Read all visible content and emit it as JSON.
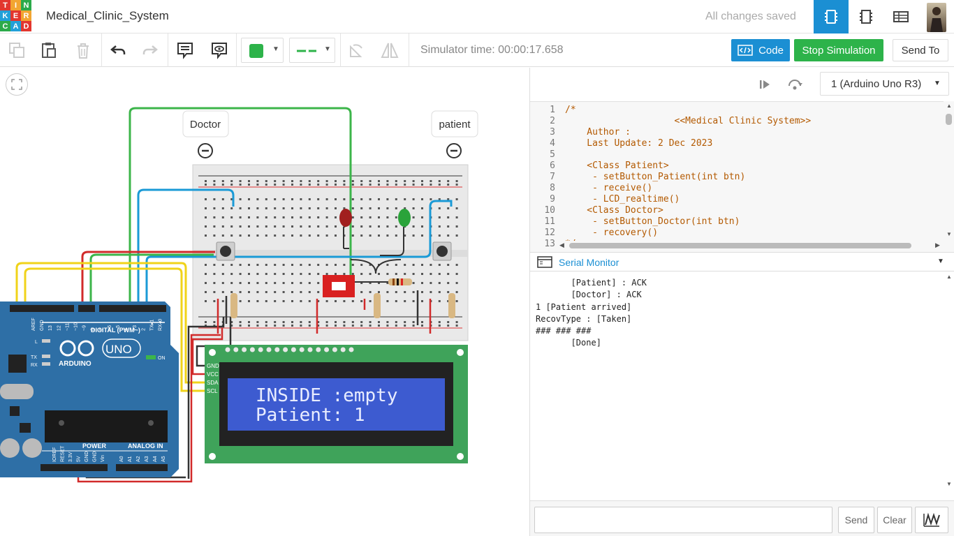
{
  "app": {
    "logo_letters": [
      "T",
      "I",
      "N",
      "K",
      "E",
      "R",
      "C",
      "A",
      "D"
    ],
    "logo_colors": [
      "#e2362e",
      "#f2a531",
      "#2caa4a",
      "#22a0d8",
      "#e2362e",
      "#f2a531",
      "#2caa4a",
      "#22a0d8",
      "#e2362e"
    ],
    "project_title": "Medical_Clinic_System",
    "save_status": "All changes saved"
  },
  "topnav": {
    "circuit_icon": "circuit-view-icon",
    "schematic_icon": "schematic-view-icon",
    "components_icon": "component-list-icon",
    "accent": "#1b8fd3"
  },
  "toolbar": {
    "simulator_time": "Simulator time: 00:00:17.658",
    "fill_color": "#2db34a",
    "code_label": "Code",
    "stop_label": "Stop Simulation",
    "send_to_label": "Send To"
  },
  "canvas": {
    "label_doctor": "Doctor",
    "label_patient": "patient",
    "lcd_line1": "INSIDE :empty",
    "lcd_line2": "Patient: 1",
    "lcd_pins": [
      "GND",
      "VCC",
      "SDA",
      "SCL"
    ],
    "arduino_brand": "ARDUINO",
    "arduino_model": "UNO",
    "arduino_digital": "DIGITAL (PWM~)",
    "arduino_power": "POWER",
    "arduino_analog": "ANALOG IN",
    "arduino_on": "ON",
    "arduino_tx": "TX",
    "arduino_rx": "RX",
    "arduino_l": "L",
    "arduino_header_pins": [
      "AREF",
      "GND",
      "13",
      "12",
      "~11",
      "~10",
      "~9",
      "8",
      "7",
      "~6",
      "~5",
      "4",
      "~3",
      "2",
      "TX▸1",
      "RX◂0"
    ],
    "power_pins": [
      "IOREF",
      "RESET",
      "3.3V",
      "5V",
      "GND",
      "GND",
      "Vin"
    ],
    "analog_pins": [
      "A0",
      "A1",
      "A2",
      "A3",
      "A4",
      "A5"
    ]
  },
  "panel": {
    "device_select": "1 (Arduino Uno R3)",
    "code_lines": [
      "/*",
      "                    <<Medical Clinic System>>",
      "    Author :",
      "    Last Update: 2 Dec 2023",
      "",
      "    <Class Patient>",
      "     - setButton_Patient(int btn)",
      "     - receive()",
      "     - LCD_realtime()",
      "    <Class Doctor>",
      "     - setButton_Doctor(int btn)",
      "     - recovery()",
      "*/"
    ],
    "line_numbers": [
      "1",
      "2",
      "3",
      "4",
      "5",
      "6",
      "7",
      "8",
      "9",
      "10",
      "11",
      "12",
      "13"
    ],
    "serial_title": "Serial Monitor",
    "serial_lines": [
      "       [Patient] : ACK",
      "       [Doctor] : ACK",
      "1 [Patient arrived]",
      "RecovType : [Taken]",
      "### ### ###",
      "       [Done]"
    ],
    "send_label": "Send",
    "clear_label": "Clear",
    "serial_input_value": ""
  }
}
